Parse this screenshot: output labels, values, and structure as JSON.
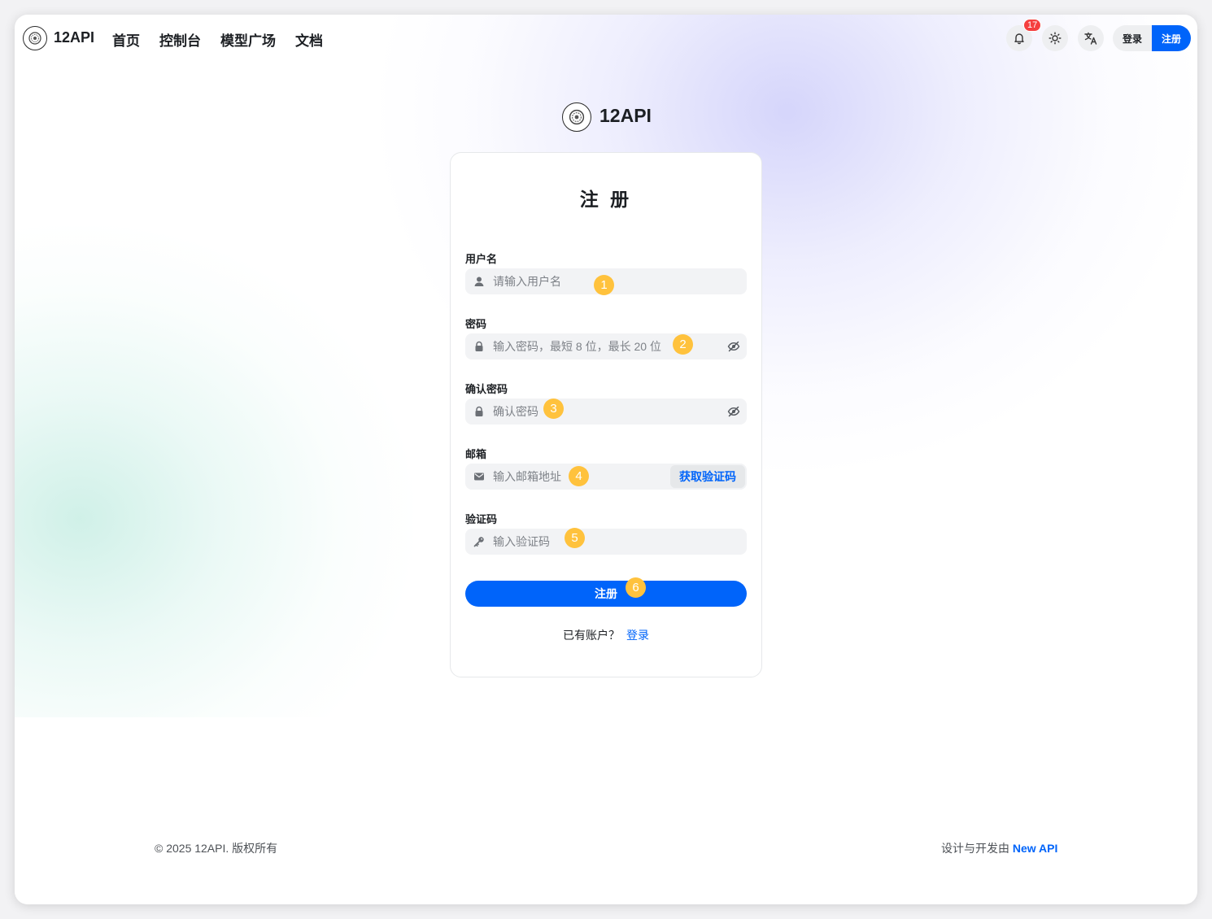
{
  "header": {
    "brand": "12API",
    "nav": [
      "首页",
      "控制台",
      "模型广场",
      "文档"
    ],
    "notification_count": "17",
    "login_label": "登录",
    "register_label": "注册"
  },
  "brand_center": {
    "name": "12API"
  },
  "form": {
    "title": "注 册",
    "username": {
      "label": "用户名",
      "placeholder": "请输入用户名"
    },
    "password": {
      "label": "密码",
      "placeholder": "输入密码，最短 8 位，最长 20 位"
    },
    "confirm_password": {
      "label": "确认密码",
      "placeholder": "确认密码"
    },
    "email": {
      "label": "邮箱",
      "placeholder": "输入邮箱地址",
      "get_code_label": "获取验证码"
    },
    "code": {
      "label": "验证码",
      "placeholder": "输入验证码"
    },
    "submit_label": "注册",
    "have_account_text": "已有账户？",
    "login_link": "登录"
  },
  "markers": [
    "1",
    "2",
    "3",
    "4",
    "5",
    "6"
  ],
  "footer": {
    "copyright": "© 2025 12API. 版权所有",
    "designed_by": "设计与开发由",
    "designed_by_link": "New API"
  },
  "colors": {
    "primary": "#0064fa",
    "marker": "#ffc23d",
    "badge": "#f53f3f"
  },
  "icons": [
    "logo-icon",
    "bell-icon",
    "sun-icon",
    "translate-icon",
    "user-icon",
    "lock-icon",
    "eye-off-icon",
    "mail-icon",
    "key-icon"
  ]
}
